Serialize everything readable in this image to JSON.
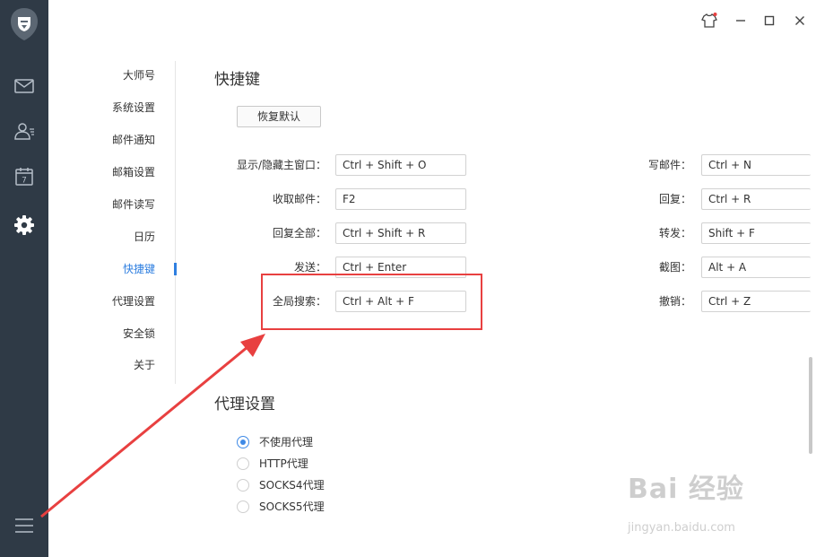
{
  "rail": {
    "icons": [
      "lion-logo-icon",
      "mail-icon",
      "contacts-icon",
      "calendar-icon",
      "gear-icon",
      "hamburger-menu-icon"
    ],
    "calendar_day": "7"
  },
  "window": {
    "icons": [
      "skin-shirt-icon",
      "minimize-icon",
      "maximize-icon",
      "close-icon"
    ]
  },
  "settings_nav": {
    "items": [
      {
        "label": "大师号"
      },
      {
        "label": "系统设置"
      },
      {
        "label": "邮件通知"
      },
      {
        "label": "邮箱设置"
      },
      {
        "label": "邮件读写"
      },
      {
        "label": "日历"
      },
      {
        "label": "快捷键",
        "active": true
      },
      {
        "label": "代理设置"
      },
      {
        "label": "安全锁"
      },
      {
        "label": "关于"
      }
    ]
  },
  "shortcuts": {
    "title": "快捷键",
    "restore_label": "恢复默认",
    "left": [
      {
        "label": "显示/隐藏主窗口：",
        "value": "Ctrl + Shift + O"
      },
      {
        "label": "收取邮件：",
        "value": "F2"
      },
      {
        "label": "回复全部：",
        "value": "Ctrl + Shift + R"
      },
      {
        "label": "发送：",
        "value": "Ctrl + Enter"
      },
      {
        "label": "全局搜索：",
        "value": "Ctrl + Alt + F"
      }
    ],
    "right": [
      {
        "label": "写邮件：",
        "value": "Ctrl + N"
      },
      {
        "label": "回复：",
        "value": "Ctrl + R"
      },
      {
        "label": "转发：",
        "value": "Shift + F"
      },
      {
        "label": "截图：",
        "value": "Alt + A"
      },
      {
        "label": "撤销：",
        "value": "Ctrl + Z"
      }
    ]
  },
  "proxy": {
    "title": "代理设置",
    "options": [
      {
        "label": "不使用代理",
        "checked": true
      },
      {
        "label": "HTTP代理",
        "checked": false
      },
      {
        "label": "SOCKS4代理",
        "checked": false
      },
      {
        "label": "SOCKS5代理",
        "checked": false
      }
    ]
  },
  "watermark": {
    "main": "Bai 经验",
    "sub": "jingyan.baidu.com"
  },
  "colors": {
    "rail_bg": "#2f3a46",
    "accent": "#2f7fe0",
    "annotation_red": "#e84040"
  }
}
